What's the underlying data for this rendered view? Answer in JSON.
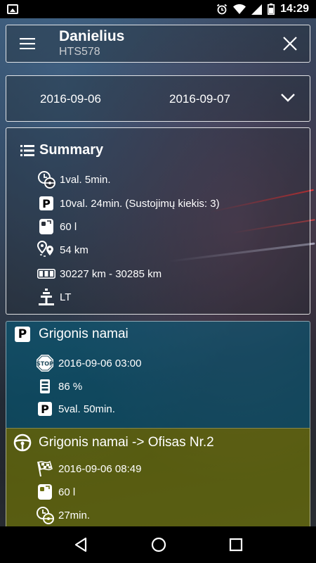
{
  "status_bar": {
    "time": "14:29"
  },
  "header": {
    "title": "Danielius",
    "subtitle": "HTS578"
  },
  "date_range": {
    "from": "2016-09-06",
    "to": "2016-09-07"
  },
  "summary": {
    "title": "Summary",
    "duration": "1val. 5min.",
    "parking": "10val. 24min. (Sustojimų kiekis: 3)",
    "fuel": "60 l",
    "distance": "54 km",
    "odometer": "30227 km - 30285 km",
    "country": "LT"
  },
  "parking_event": {
    "title": "Grigonis namai",
    "stop_time": "2016-09-06 03:00",
    "level": "86  %",
    "duration": "5val. 50min."
  },
  "drive_event": {
    "title": "Grigonis namai -> Ofisas Nr.2",
    "start_time": "2016-09-06 08:49",
    "fuel": "60 l",
    "duration": "27min."
  }
}
